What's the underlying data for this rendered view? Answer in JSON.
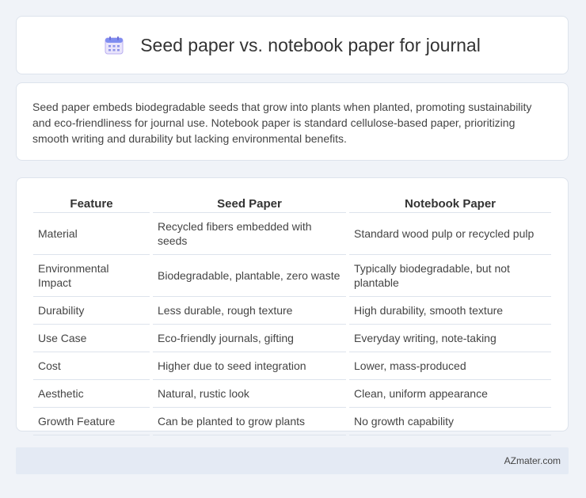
{
  "header": {
    "icon": "calendar-icon",
    "title": "Seed paper vs. notebook paper for journal"
  },
  "summary": "Seed paper embeds biodegradable seeds that grow into plants when planted, promoting sustainability and eco-friendliness for journal use. Notebook paper is standard cellulose-based paper, prioritizing smooth writing and durability but lacking environmental benefits.",
  "table": {
    "headers": [
      "Feature",
      "Seed Paper",
      "Notebook Paper"
    ],
    "rows": [
      [
        "Material",
        "Recycled fibers embedded with seeds",
        "Standard wood pulp or recycled pulp"
      ],
      [
        "Environmental Impact",
        "Biodegradable, plantable, zero waste",
        "Typically biodegradable, but not plantable"
      ],
      [
        "Durability",
        "Less durable, rough texture",
        "High durability, smooth texture"
      ],
      [
        "Use Case",
        "Eco-friendly journals, gifting",
        "Everyday writing, note-taking"
      ],
      [
        "Cost",
        "Higher due to seed integration",
        "Lower, mass-produced"
      ],
      [
        "Aesthetic",
        "Natural, rustic look",
        "Clean, uniform appearance"
      ],
      [
        "Growth Feature",
        "Can be planted to grow plants",
        "No growth capability"
      ]
    ]
  },
  "footer": {
    "text": "AZmater.com"
  },
  "colors": {
    "background": "#f0f3f8",
    "card": "#ffffff",
    "border": "#dde3ec",
    "footer": "#e4eaf4"
  }
}
